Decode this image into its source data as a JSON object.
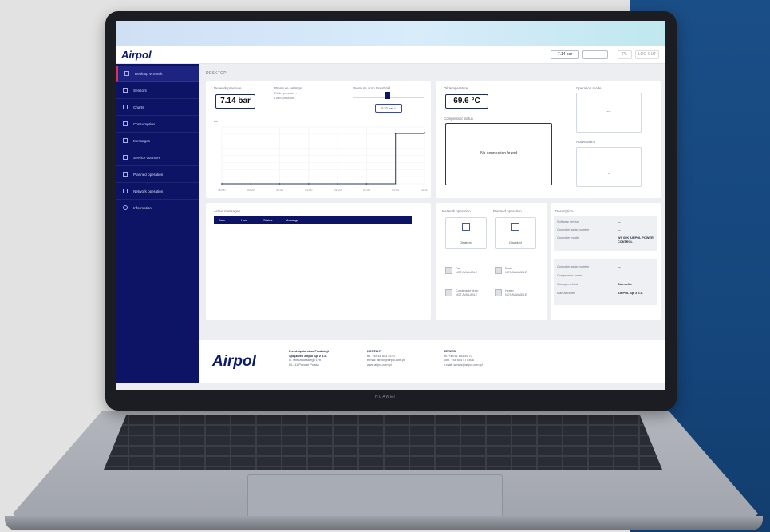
{
  "colors": {
    "navy": "#0d1466",
    "accent_red": "#e0314b",
    "page_bg": "#eceef2",
    "blue_bg": "#15467c"
  },
  "app": {
    "logo": "Airpol",
    "breadcrumb": "DESKTOP"
  },
  "topbar": {
    "pressure_btn": "7.14 bar",
    "btn2": "---",
    "btn3": "PL",
    "btn4": "LOG OUT"
  },
  "sidebar": {
    "items": [
      {
        "label": "Desktop WS-60k",
        "icon": "monitor-icon"
      },
      {
        "label": "Sensors",
        "icon": "sensor-icon"
      },
      {
        "label": "Charts",
        "icon": "chart-icon"
      },
      {
        "label": "Consumption",
        "icon": "consumption-icon"
      },
      {
        "label": "Messages",
        "icon": "message-icon"
      },
      {
        "label": "Service counters",
        "icon": "counter-icon"
      },
      {
        "label": "Planned operation",
        "icon": "calendar-icon"
      },
      {
        "label": "Network operation",
        "icon": "network-icon"
      },
      {
        "label": "Information",
        "icon": "info-icon"
      }
    ]
  },
  "pressure_panel": {
    "network_label": "Network pressure",
    "network_value": "7.14 bar",
    "settings_label": "Pressure settings",
    "settings_rows": [
      "Relief pressure  -",
      "Load pressure  -"
    ],
    "drop_label": "Pressure drop threshold",
    "drop_button": "0.37 bar ↑",
    "unit": "bar"
  },
  "chart_data": {
    "type": "line",
    "ylabel": "bar",
    "x": [
      "00:00",
      "00:20",
      "00:40",
      "01:00",
      "01:20",
      "01:40",
      "02:00",
      "02:20"
    ],
    "series": [
      {
        "values": [
          0.0,
          0.0,
          0.0,
          0.0,
          0.0,
          0.0,
          7.1,
          7.2
        ]
      }
    ],
    "ylim": [
      0,
      8
    ],
    "grid": true
  },
  "temp_panel": {
    "oil_label": "Oil temperature",
    "oil_value": "69.6 °C",
    "status_label": "Compressor status",
    "status_text": "No connection found",
    "op_mode_label": "Operation mode",
    "op_mode_value": "---",
    "alarm_label": "Active alarm",
    "alarm_value": "-"
  },
  "messages_panel": {
    "label": "Active messages",
    "columns": [
      "Date",
      "Hour",
      "Status",
      "Message"
    ]
  },
  "operation_panel": {
    "network_label": "Network operation",
    "network_state": "Disabled",
    "planned_label": "Planned operation",
    "planned_state": "Disabled",
    "items": [
      {
        "name": "Fan",
        "state": "NOT AVAILABLE"
      },
      {
        "name": "Drain",
        "state": "NOT AVAILABLE"
      },
      {
        "name": "Condensate drain",
        "state": "NOT AVAILABLE"
      },
      {
        "name": "Heater",
        "state": "NOT AVAILABLE"
      }
    ]
  },
  "info_panel": {
    "label": "Description",
    "rows_top": [
      {
        "k": "Software version",
        "v": "---"
      },
      {
        "k": "Controller serial number",
        "v": "---"
      },
      {
        "k": "Controller model",
        "v": "WS 60K AIRPOL POWER CONTROL"
      }
    ],
    "rows_bottom": [
      {
        "k": "Controller serial number",
        "v": "---"
      },
      {
        "k": "Compressor name",
        "v": ""
      },
      {
        "k": "Startup method",
        "v": "Star-delta"
      },
      {
        "k": "Manufacturer",
        "v": "AIRPOL Sp. z o.o."
      }
    ]
  },
  "footer": {
    "logo": "Airpol",
    "company": [
      "Przedsiębiorstwo Produkcji",
      "Sprężarek Airpol Sp. z o.o.",
      "ul. Mieszkowskiego 17b",
      "60-111 Poznań Polska"
    ],
    "contact_title": "KONTAKT",
    "contact": [
      "tel. +48 61 653 45 67",
      "e-mail: airpol@airpol.com.pl",
      "www.airpol.com.pl"
    ],
    "service_title": "SERWIS",
    "service": [
      "tel. +48 61 653 45 70",
      "kom. +48 604 477 806",
      "e-mail: serwis@airpol.com.pl"
    ]
  },
  "device": {
    "brand": "HUAWEI"
  }
}
